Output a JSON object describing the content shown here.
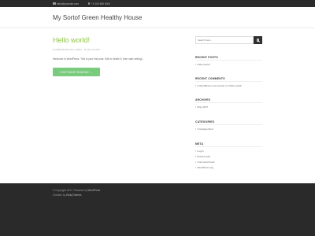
{
  "topbar": {
    "email": "hello@yoursite.com",
    "phone": "+1 000 555 0000"
  },
  "header": {
    "site_title": "My Sortof Green Healthy House"
  },
  "post": {
    "title": "Hello world!",
    "author": "ADMINISTRATOR, 0 ITEM",
    "date": "MAY 31 2017",
    "excerpt": "Welcome to WordPress. This is your first post. Edit or delete it, then start writing!...",
    "continue_label": "CONTINUE READING →"
  },
  "sidebar": {
    "search_placeholder": "Search here...",
    "recent_posts": {
      "title": "RECENT POSTS",
      "items": [
        "Hello world!"
      ]
    },
    "recent_comments": {
      "title": "RECENT COMMENTS",
      "items": [
        "A WordPress Commenter on Hello world!"
      ]
    },
    "archives": {
      "title": "ARCHIVES",
      "items": [
        "May 2017"
      ]
    },
    "categories": {
      "title": "CATEGORIES",
      "items": [
        "Uncategorized"
      ]
    },
    "meta": {
      "title": "META",
      "items": [
        "Log in",
        "Entries feed",
        "Comments feed",
        "WordPress.org"
      ]
    }
  },
  "footer": {
    "copyright": "© Copyright 2017. Powered by",
    "powered_link": "WordPress",
    "credit_prefix": "Creation by",
    "credit_link": "RickyThemes"
  },
  "colors": {
    "accent_green": "#8dc63f",
    "button_green": "#7acb7e",
    "dark": "#2a2a2a"
  }
}
